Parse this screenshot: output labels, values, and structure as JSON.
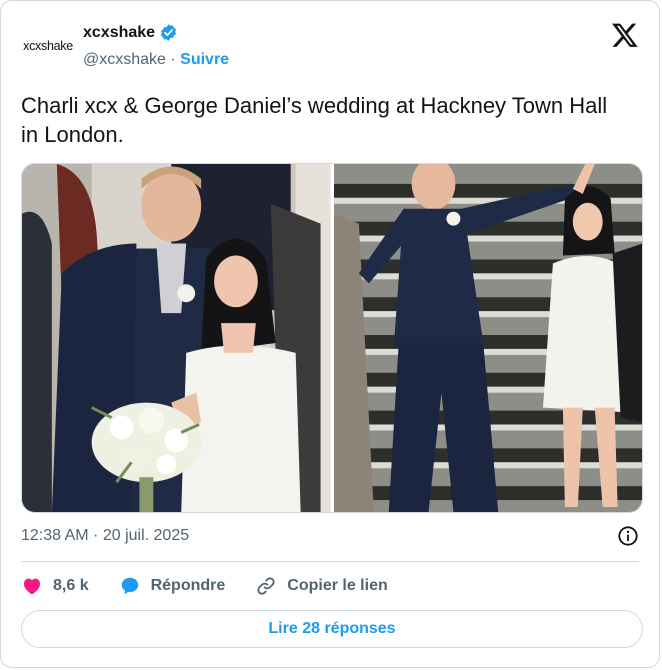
{
  "author": {
    "avatar_text": "xcxshake",
    "display_name": "xcxshake",
    "handle": "@xcxshake",
    "separator": " · ",
    "follow_label": "Suivre",
    "verified": true
  },
  "tweet": {
    "text": "Charli xcx & George Daniel’s wedding at Hackney Town Hall in London.",
    "timestamp": "12:38 AM · 20 juil. 2025"
  },
  "actions": {
    "likes": "8,6 k",
    "reply_label": "Répondre",
    "copy_link_label": "Copier le lien"
  },
  "footer": {
    "read_replies_label": "Lire 28 réponses"
  },
  "colors": {
    "accent": "#1d9bf0",
    "like": "#f91880",
    "muted": "#536471",
    "border": "#cfd9de"
  },
  "icons": [
    "verified-badge-icon",
    "x-logo-icon",
    "info-icon",
    "heart-icon",
    "reply-bubble-icon",
    "link-icon"
  ]
}
